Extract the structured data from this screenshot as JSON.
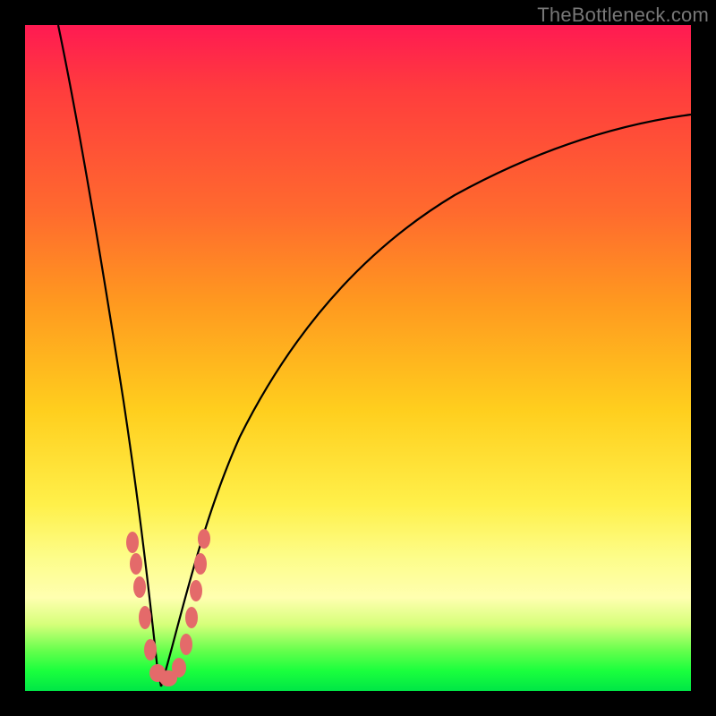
{
  "watermark": "TheBottleneck.com",
  "colors": {
    "frame": "#000000",
    "gradient_top": "#ff1a52",
    "gradient_mid": "#ffcf1e",
    "gradient_bottom": "#00e646",
    "curve": "#000000",
    "markers": "#e46a6a"
  },
  "chart_data": {
    "type": "line",
    "title": "",
    "xlabel": "",
    "ylabel": "",
    "xlim": [
      0,
      100
    ],
    "ylim": [
      0,
      100
    ],
    "grid": false,
    "legend": false,
    "series": [
      {
        "name": "left-curve",
        "x": [
          5,
          7,
          9,
          11,
          13,
          15,
          16,
          17,
          18,
          19,
          20
        ],
        "y": [
          100,
          85,
          70,
          56,
          43,
          30,
          22,
          15,
          9,
          4,
          0
        ]
      },
      {
        "name": "right-curve",
        "x": [
          20,
          22,
          25,
          28,
          32,
          38,
          45,
          55,
          65,
          75,
          85,
          95,
          100
        ],
        "y": [
          0,
          8,
          18,
          28,
          38,
          48,
          57,
          66,
          73,
          78,
          82,
          85,
          86
        ]
      }
    ],
    "markers": {
      "name": "highlighted-points",
      "x": [
        16.0,
        16.5,
        17.0,
        17.8,
        18.5,
        19.5,
        20.8,
        21.8,
        23.0,
        24.0,
        24.8,
        25.5,
        26.0
      ],
      "y": [
        22,
        18,
        14,
        9,
        5,
        2,
        2,
        4,
        8,
        12,
        16,
        20,
        24
      ]
    }
  }
}
